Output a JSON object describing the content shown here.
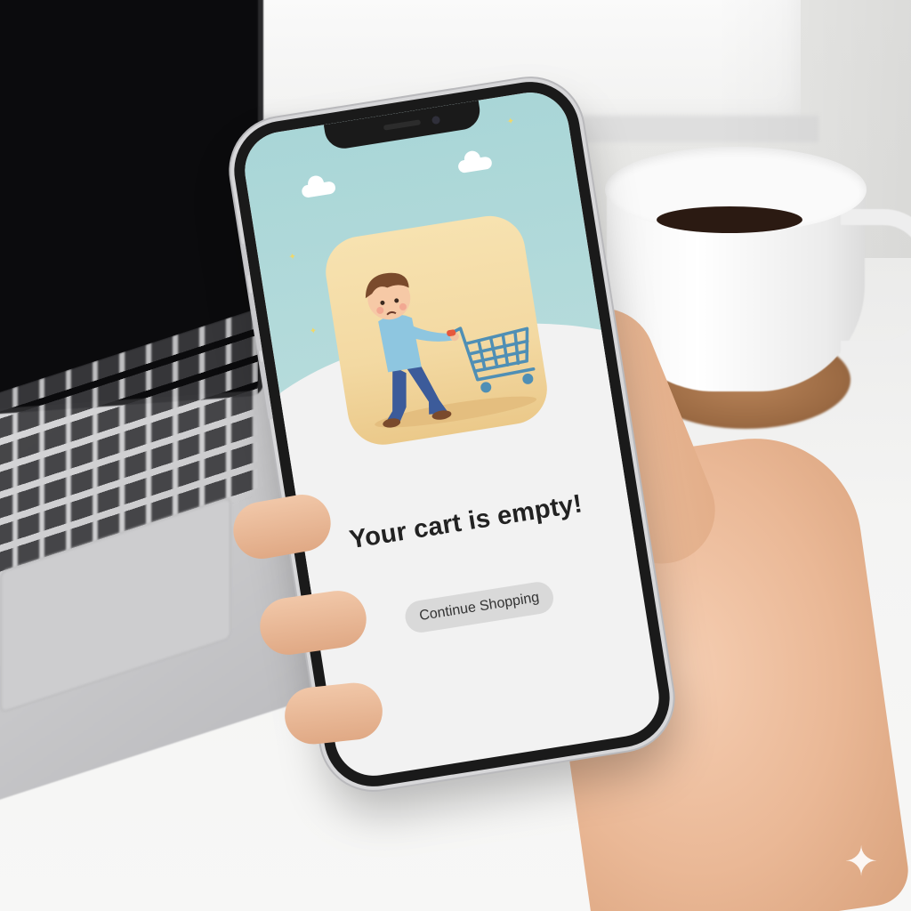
{
  "screen": {
    "title": "Your cart is empty!",
    "button_label": "Continue Shopping"
  },
  "icons": {
    "illustration": "sad-boy-pushing-empty-cart-illustration",
    "decor": [
      "cloud-icon",
      "star-icon"
    ],
    "watermark": "sparkle-icon"
  },
  "colors": {
    "sky": "#a9d6d7",
    "illustration_bg": "#f3d9a2",
    "title": "#222222",
    "button_bg": "#d9d9d9",
    "button_text": "#333333"
  }
}
